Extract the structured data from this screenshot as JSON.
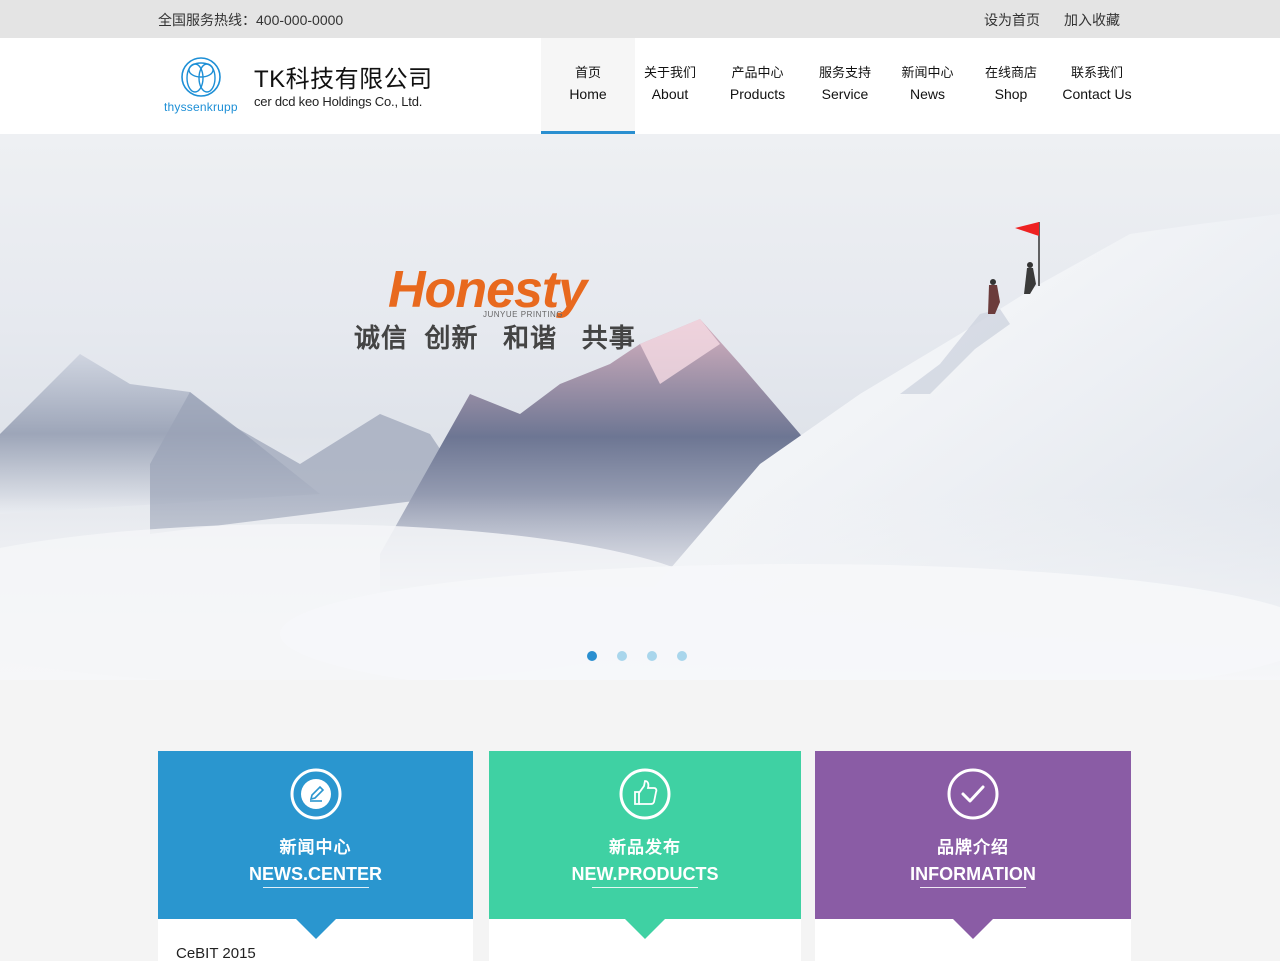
{
  "topbar": {
    "hotline": "全国服务热线：400-000-0000",
    "set_home": "设为首页",
    "bookmark": "加入收藏"
  },
  "header": {
    "logo_text": "thyssenkrupp",
    "company_cn": "TK科技有限公司",
    "company_en": "cer dcd keo Holdings Co., Ltd."
  },
  "nav": [
    {
      "zh": "首页",
      "en": "Home",
      "active": true
    },
    {
      "zh": "关于我们",
      "en": "About"
    },
    {
      "zh": "产品中心",
      "en": "Products"
    },
    {
      "zh": "服务支持",
      "en": "Service"
    },
    {
      "zh": "新闻中心",
      "en": "News"
    },
    {
      "zh": "在线商店",
      "en": "Shop"
    },
    {
      "zh": "联系我们",
      "en": "Contact Us"
    }
  ],
  "banner": {
    "slogan": "Honesty",
    "slogan_sub": "JUNYUE PRINTING",
    "slogan_cn": "诚信  创新   和谐   共事",
    "slide_count": 4,
    "active_slide": 1,
    "accent_color": "#e8691e"
  },
  "cards": [
    {
      "title_cn": "新闻中心",
      "title_en": "NEWS.CENTER",
      "icon": "pencil-icon",
      "color": "#2a96cf",
      "first_item": "CeBIT 2015"
    },
    {
      "title_cn": "新品发布",
      "title_en": "NEW.PRODUCTS",
      "icon": "thumbs-up-icon",
      "color": "#3fd1a3",
      "first_item": ""
    },
    {
      "title_cn": "品牌介绍",
      "title_en": "INFORMATION",
      "icon": "check-icon",
      "color": "#8a5ca5",
      "first_item": ""
    }
  ],
  "colors": {
    "nav_active_underline": "#2a8fd0",
    "topbar_bg": "#e4e4e4"
  }
}
